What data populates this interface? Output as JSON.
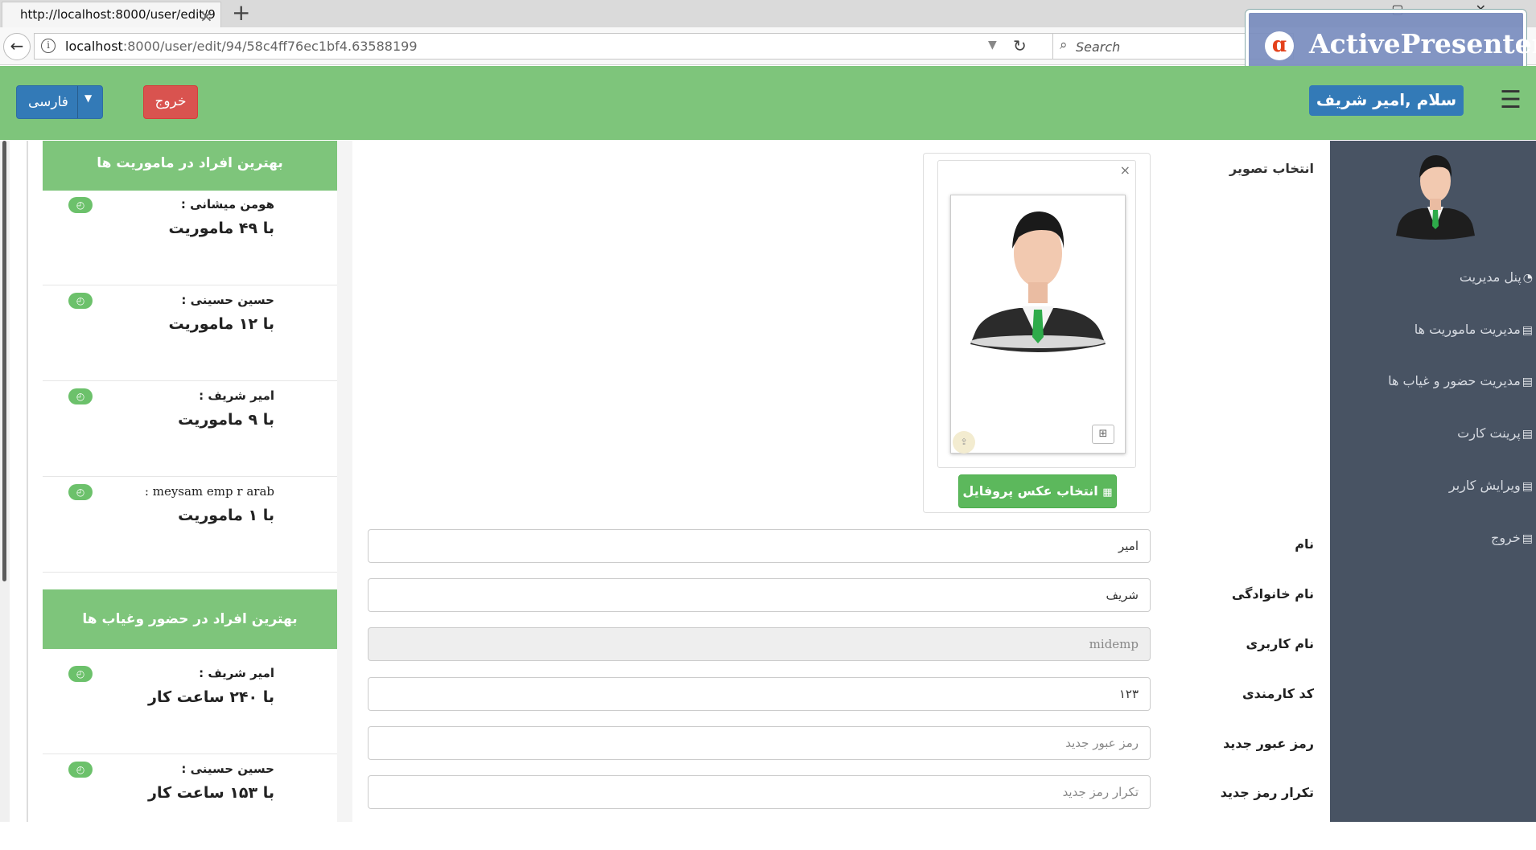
{
  "browser": {
    "tab_title": "http://localhost:8000/user/edit/9",
    "new_tab_icon": "plus-icon",
    "url_host": "localhost",
    "url_rest": ":8000/user/edit/94/58c4ff76ec1bf4.63588199",
    "search_placeholder": "Search",
    "window_controls": "— ▢ ✕"
  },
  "watermark": {
    "text": "ActivePresenter",
    "logo_glyph": "ɑ"
  },
  "header": {
    "language_label": "فارسی",
    "logout_label": "خروج",
    "greeting": "سلام ,امیر شریف",
    "bg_color": "#7ec57b"
  },
  "leaderboards": [
    {
      "title": "بهترین افراد در ماموریت ها",
      "items": [
        {
          "name": "هومن میشانی :",
          "count": "با ۴۹ ماموریت"
        },
        {
          "name": "حسین حسینی :",
          "count": "با ۱۲ ماموریت"
        },
        {
          "name": "امیر شریف :",
          "count": "با ۹ ماموریت"
        },
        {
          "name": "meysam emp r arab :",
          "count": "با ۱ ماموریت"
        }
      ]
    },
    {
      "title": "بهترین افراد در حضور وغیاب ها",
      "items": [
        {
          "name": "امیر شریف :",
          "count": "با ۲۴۰ ساعت کار"
        },
        {
          "name": "حسین حسینی :",
          "count": "با ۱۵۳ ساعت کار"
        }
      ]
    }
  ],
  "form": {
    "picture_label": "انتخاب تصویر",
    "picture_close": "×",
    "select_photo_button": "انتخاب عکس پروفایل",
    "fields": [
      {
        "label": "نام",
        "value": "امیر",
        "placeholder": ""
      },
      {
        "label": "نام خانوادگی",
        "value": "شریف",
        "placeholder": ""
      },
      {
        "label": "نام کاربری",
        "value": "midemp",
        "placeholder": "",
        "disabled": true
      },
      {
        "label": "کد کارمندی",
        "value": "۱۲۳",
        "placeholder": ""
      },
      {
        "label": "رمز عبور جدید",
        "value": "",
        "placeholder": "رمز عبور جدید"
      },
      {
        "label": "تکرار رمز جدید",
        "value": "",
        "placeholder": "تکرار رمز جدید"
      }
    ]
  },
  "sidebar": {
    "items": [
      {
        "label": "پنل مدیریت",
        "icon": "dashboard-icon"
      },
      {
        "label": "مدیریت ماموریت ها",
        "icon": "book-icon"
      },
      {
        "label": "مدیریت حضور و غیاب ها",
        "icon": "book-icon"
      },
      {
        "label": "پرینت کارت",
        "icon": "book-icon"
      },
      {
        "label": "ویرایش کاربر",
        "icon": "book-icon"
      },
      {
        "label": "خروج",
        "icon": "book-icon"
      }
    ]
  }
}
